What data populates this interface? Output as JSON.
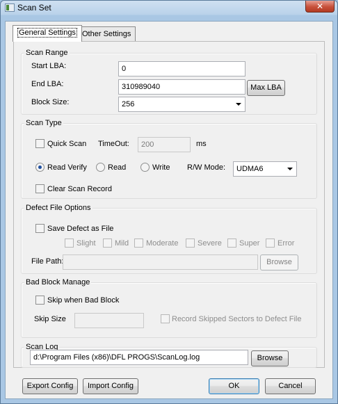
{
  "window": {
    "title": "Scan Set",
    "close_glyph": "✕"
  },
  "tabs": {
    "general": "General Settings",
    "other": "Other Settings"
  },
  "scan_range": {
    "title": "Scan Range",
    "start_lba_label": "Start LBA:",
    "start_lba_value": "0",
    "end_lba_label": "End LBA:",
    "end_lba_value": "310989040",
    "max_lba_button": "Max LBA",
    "block_size_label": "Block Size:",
    "block_size_value": "256"
  },
  "scan_type": {
    "title": "Scan Type",
    "quick_scan_label": "Quick Scan",
    "timeout_label": "TimeOut:",
    "timeout_value": "200",
    "timeout_unit": "ms",
    "read_verify_label": "Read Verify",
    "read_label": "Read",
    "write_label": "Write",
    "selected_mode": "Read Verify",
    "rw_mode_label": "R/W Mode:",
    "rw_mode_value": "UDMA6",
    "clear_record_label": "Clear Scan Record"
  },
  "defect": {
    "title": "Defect File Options",
    "save_label": "Save Defect as File",
    "levels": [
      "Slight",
      "Mild",
      "Moderate",
      "Severe",
      "Super",
      "Error"
    ],
    "file_path_label": "File Path:",
    "file_path_value": "",
    "browse_button": "Browse"
  },
  "bad_block": {
    "title": "Bad Block Manage",
    "skip_label": "Skip when Bad Block",
    "skip_size_label": "Skip Size",
    "skip_size_value": "",
    "record_label": "Record Skipped Sectors to Defect File"
  },
  "scan_log": {
    "title": "Scan Log",
    "path_value": "d:\\Program Files (x86)\\DFL PROGS\\ScanLog.log",
    "browse_button": "Browse"
  },
  "footer": {
    "export_button": "Export Config",
    "import_button": "Import Config",
    "ok_button": "OK",
    "cancel_button": "Cancel"
  }
}
